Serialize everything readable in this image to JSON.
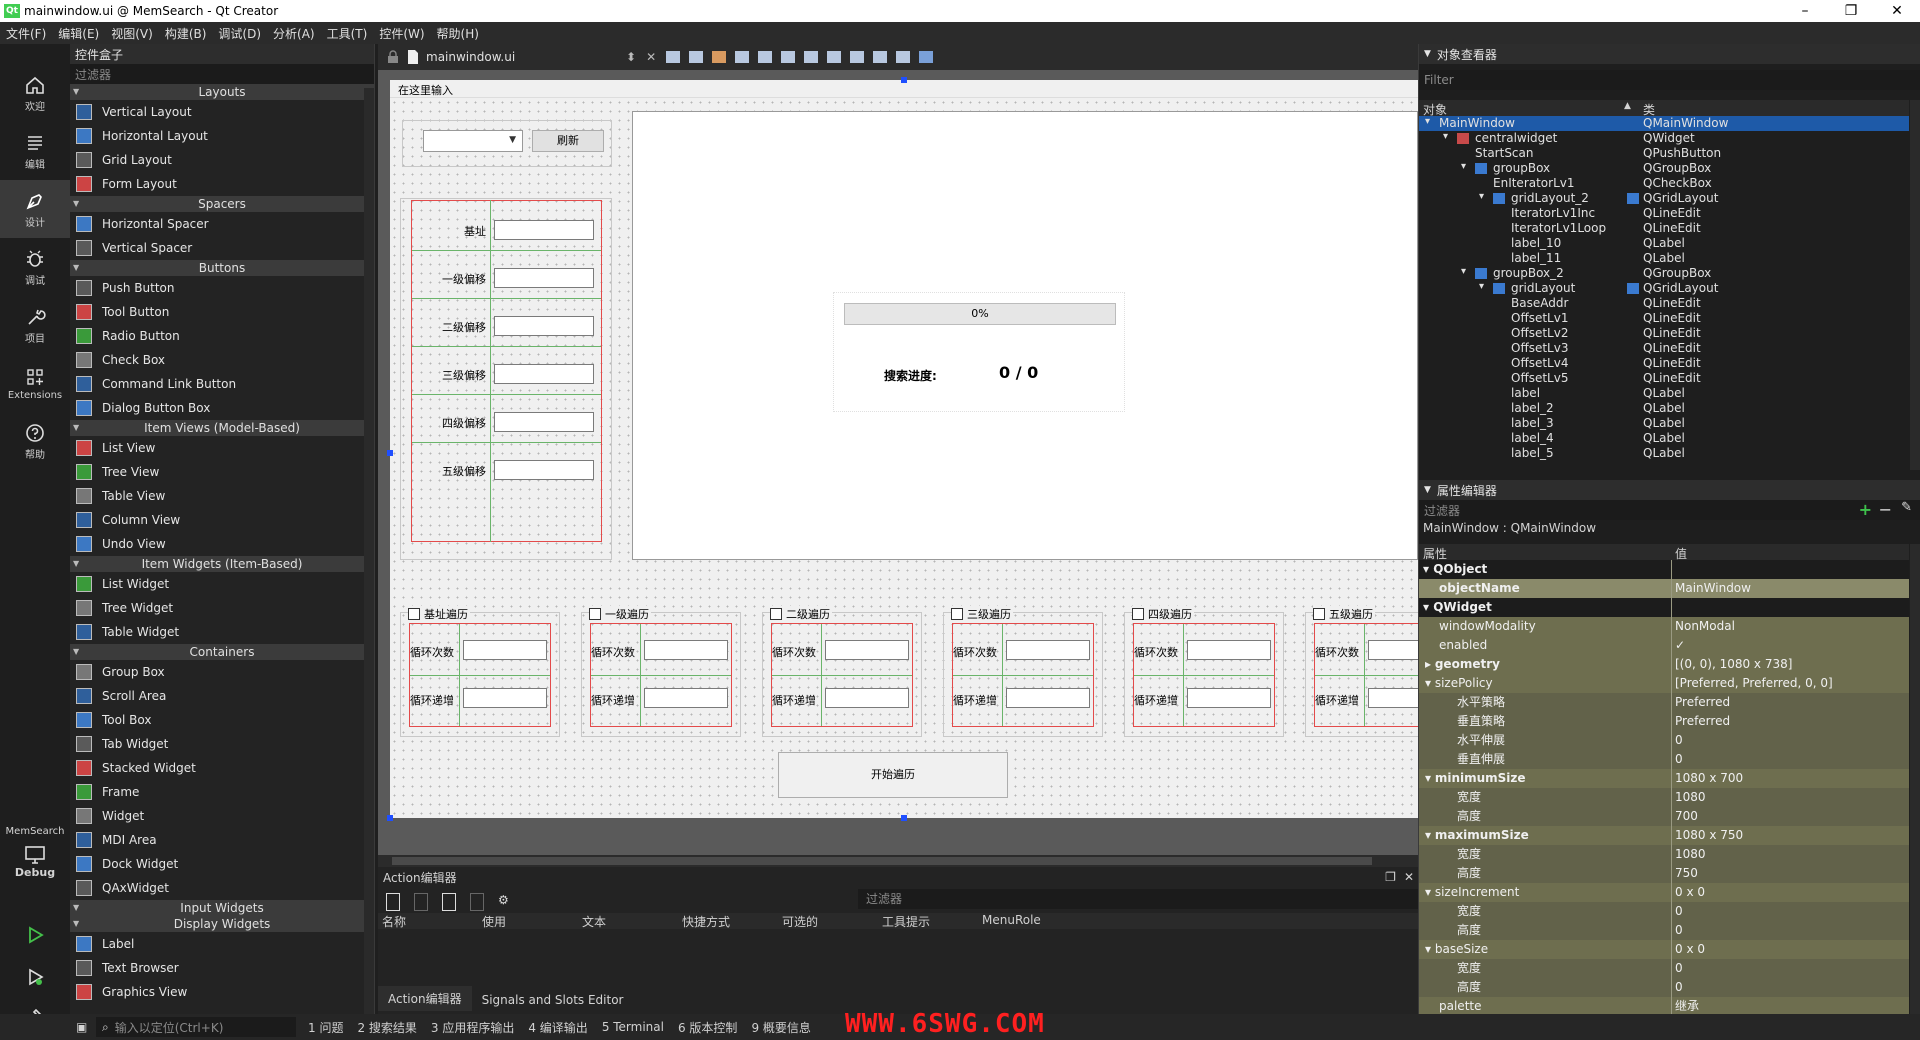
{
  "window": {
    "title": "mainwindow.ui @ MemSearch - Qt Creator",
    "minimize": "–",
    "maximize": "❐",
    "close": "✕"
  },
  "menu": [
    "文件(F)",
    "编辑(E)",
    "视图(V)",
    "构建(B)",
    "调试(D)",
    "分析(A)",
    "工具(T)",
    "控件(W)",
    "帮助(H)"
  ],
  "modes": [
    {
      "label": "欢迎",
      "icon": "home-icon"
    },
    {
      "label": "编辑",
      "icon": "edit-icon"
    },
    {
      "label": "设计",
      "icon": "design-pen-icon",
      "active": true
    },
    {
      "label": "调试",
      "icon": "bug-icon"
    },
    {
      "label": "项目",
      "icon": "wrench-icon"
    },
    {
      "label": "Extensions",
      "icon": "extensions-icon"
    },
    {
      "label": "帮助",
      "icon": "help-icon"
    }
  ],
  "kit": {
    "project": "MemSearch",
    "config": "Debug"
  },
  "widget_box": {
    "title": "控件盒子",
    "filter_placeholder": "过滤器",
    "categories": [
      {
        "name": "Layouts",
        "items": [
          "Vertical Layout",
          "Horizontal Layout",
          "Grid Layout",
          "Form Layout"
        ]
      },
      {
        "name": "Spacers",
        "items": [
          "Horizontal Spacer",
          "Vertical Spacer"
        ]
      },
      {
        "name": "Buttons",
        "items": [
          "Push Button",
          "Tool Button",
          "Radio Button",
          "Check Box",
          "Command Link Button",
          "Dialog Button Box"
        ]
      },
      {
        "name": "Item Views (Model-Based)",
        "items": [
          "List View",
          "Tree View",
          "Table View",
          "Column View",
          "Undo View"
        ]
      },
      {
        "name": "Item Widgets (Item-Based)",
        "items": [
          "List Widget",
          "Tree Widget",
          "Table Widget"
        ]
      },
      {
        "name": "Containers",
        "items": [
          "Group Box",
          "Scroll Area",
          "Tool Box",
          "Tab Widget",
          "Stacked Widget",
          "Frame",
          "Widget",
          "MDI Area",
          "Dock Widget",
          "QAxWidget"
        ]
      },
      {
        "name": "Input Widgets",
        "items": []
      },
      {
        "name": "Display Widgets",
        "items": [
          "Label",
          "Text Browser",
          "Graphics View"
        ]
      }
    ]
  },
  "editor": {
    "file_tab": "mainwindow.ui",
    "menu_placeholder": "在这里输入",
    "refresh_button": "刷新",
    "progress_text": "0%",
    "progress_value": 0,
    "search_progress_label": "搜索进度:",
    "search_progress_value": "0 / 0",
    "offset_labels": [
      "基址",
      "一级偏移",
      "二级偏移",
      "三级偏移",
      "四级偏移",
      "五级偏移"
    ],
    "loop_groups": [
      "基址遍历",
      "一级遍历",
      "二级遍历",
      "三级遍历",
      "四级遍历",
      "五级遍历"
    ],
    "loop_count_label": "循环次数",
    "loop_inc_label": "循环递增",
    "start_button": "开始遍历"
  },
  "action_editor": {
    "title": "Action编辑器",
    "filter_placeholder": "过滤器",
    "columns": [
      "名称",
      "使用",
      "文本",
      "快捷方式",
      "可选的",
      "工具提示",
      "MenuRole"
    ],
    "tabs": [
      "Action编辑器",
      "Signals and Slots Editor"
    ]
  },
  "object_inspector": {
    "title": "对象查看器",
    "filter_placeholder": "Filter",
    "col_object": "对象",
    "col_class": "类",
    "rows": [
      {
        "name": "MainWindow",
        "class": "QMainWindow",
        "level": 0,
        "selected": true
      },
      {
        "name": "centralwidget",
        "class": "QWidget",
        "level": 1
      },
      {
        "name": "StartScan",
        "class": "QPushButton",
        "level": 2
      },
      {
        "name": "groupBox",
        "class": "QGroupBox",
        "level": 2
      },
      {
        "name": "EnIteratorLv1",
        "class": "QCheckBox",
        "level": 3
      },
      {
        "name": "gridLayout_2",
        "class": "QGridLayout",
        "level": 3
      },
      {
        "name": "IteratorLv1Inc",
        "class": "QLineEdit",
        "level": 4
      },
      {
        "name": "IteratorLv1Loop",
        "class": "QLineEdit",
        "level": 4
      },
      {
        "name": "label_10",
        "class": "QLabel",
        "level": 4
      },
      {
        "name": "label_11",
        "class": "QLabel",
        "level": 4
      },
      {
        "name": "groupBox_2",
        "class": "QGroupBox",
        "level": 2
      },
      {
        "name": "gridLayout",
        "class": "QGridLayout",
        "level": 3
      },
      {
        "name": "BaseAddr",
        "class": "QLineEdit",
        "level": 4
      },
      {
        "name": "OffsetLv1",
        "class": "QLineEdit",
        "level": 4
      },
      {
        "name": "OffsetLv2",
        "class": "QLineEdit",
        "level": 4
      },
      {
        "name": "OffsetLv3",
        "class": "QLineEdit",
        "level": 4
      },
      {
        "name": "OffsetLv4",
        "class": "QLineEdit",
        "level": 4
      },
      {
        "name": "OffsetLv5",
        "class": "QLineEdit",
        "level": 4
      },
      {
        "name": "label",
        "class": "QLabel",
        "level": 4
      },
      {
        "name": "label_2",
        "class": "QLabel",
        "level": 4
      },
      {
        "name": "label_3",
        "class": "QLabel",
        "level": 4
      },
      {
        "name": "label_4",
        "class": "QLabel",
        "level": 4
      },
      {
        "name": "label_5",
        "class": "QLabel",
        "level": 4
      }
    ]
  },
  "property_editor": {
    "title": "属性编辑器",
    "filter_placeholder": "过滤器",
    "context": "MainWindow : QMainWindow",
    "col_property": "属性",
    "col_value": "值",
    "rows": [
      {
        "key": "QObject",
        "value": "",
        "type": "hdr"
      },
      {
        "key": "objectName",
        "value": "MainWindow",
        "type": "sel",
        "bold": true
      },
      {
        "key": "QWidget",
        "value": "",
        "type": "hdr"
      },
      {
        "key": "windowModality",
        "value": "NonModal",
        "type": "olive"
      },
      {
        "key": "enabled",
        "value": "✓",
        "type": "olive"
      },
      {
        "key": "geometry",
        "value": "[(0, 0), 1080 x 738]",
        "type": "olive",
        "bold": true,
        "expander": "▸"
      },
      {
        "key": "sizePolicy",
        "value": "[Preferred, Preferred, 0, 0]",
        "type": "olive",
        "expander": "▾"
      },
      {
        "key": "水平策略",
        "value": "Preferred",
        "type": "olive2",
        "sub": true
      },
      {
        "key": "垂直策略",
        "value": "Preferred",
        "type": "olive2",
        "sub": true
      },
      {
        "key": "水平伸展",
        "value": "0",
        "type": "olive2",
        "sub": true
      },
      {
        "key": "垂直伸展",
        "value": "0",
        "type": "olive2",
        "sub": true
      },
      {
        "key": "minimumSize",
        "value": "1080 x 700",
        "type": "olive",
        "bold": true,
        "expander": "▾"
      },
      {
        "key": "宽度",
        "value": "1080",
        "type": "olive2",
        "sub": true
      },
      {
        "key": "高度",
        "value": "700",
        "type": "olive2",
        "sub": true
      },
      {
        "key": "maximumSize",
        "value": "1080 x 750",
        "type": "olive",
        "bold": true,
        "expander": "▾"
      },
      {
        "key": "宽度",
        "value": "1080",
        "type": "olive2",
        "sub": true
      },
      {
        "key": "高度",
        "value": "750",
        "type": "olive2",
        "sub": true
      },
      {
        "key": "sizeIncrement",
        "value": "0 x 0",
        "type": "olive",
        "expander": "▾"
      },
      {
        "key": "宽度",
        "value": "0",
        "type": "olive2",
        "sub": true
      },
      {
        "key": "高度",
        "value": "0",
        "type": "olive2",
        "sub": true
      },
      {
        "key": "baseSize",
        "value": "0 x 0",
        "type": "olive",
        "expander": "▾"
      },
      {
        "key": "宽度",
        "value": "0",
        "type": "olive2",
        "sub": true
      },
      {
        "key": "高度",
        "value": "0",
        "type": "olive2",
        "sub": true
      },
      {
        "key": "palette",
        "value": "继承",
        "type": "olive"
      }
    ]
  },
  "status_bar": {
    "locator_placeholder": "输入以定位(Ctrl+K)",
    "panes": [
      "1 问题",
      "2 搜索结果",
      "3 应用程序输出",
      "4 编译输出",
      "5 Terminal",
      "6 版本控制",
      "9 概要信息"
    ]
  },
  "watermark": "WWW.6SWG.COM"
}
